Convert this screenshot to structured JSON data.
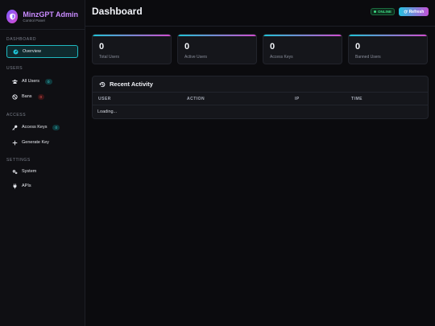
{
  "brand": {
    "title": "MinzGPT Admin",
    "subtitle": "Control Panel"
  },
  "sidebar": {
    "sections": {
      "dashboard": "DASHBOARD",
      "users": "USERS",
      "access": "ACCESS",
      "settings": "SETTINGS"
    },
    "items": {
      "overview": {
        "label": "Overview",
        "icon": "gauge-icon",
        "active": true
      },
      "all_users": {
        "label": "All Users",
        "icon": "users-icon",
        "badge": "0"
      },
      "bans": {
        "label": "Bans",
        "icon": "ban-icon",
        "badge": "0"
      },
      "access_keys": {
        "label": "Access Keys",
        "icon": "key-icon",
        "badge": "0"
      },
      "generate_key": {
        "label": "Generate Key",
        "icon": "plus-icon"
      },
      "system": {
        "label": "System",
        "icon": "gears-icon"
      },
      "apis": {
        "label": "APIs",
        "icon": "plug-icon"
      }
    }
  },
  "header": {
    "title": "Dashboard",
    "status": "ONLINE",
    "refresh_label": "Refresh"
  },
  "stats": [
    {
      "value": "0",
      "label": "Total Users"
    },
    {
      "value": "0",
      "label": "Active Users"
    },
    {
      "value": "0",
      "label": "Access Keys"
    },
    {
      "value": "0",
      "label": "Banned Users"
    }
  ],
  "activity": {
    "title": "Recent Activity",
    "columns": [
      "USER",
      "ACTION",
      "IP",
      "TIME"
    ],
    "loading_text": "Loading..."
  },
  "colors": {
    "accent_teal": "#1fc3d6",
    "accent_magenta": "#d24ccf",
    "online_green": "#3ddc84",
    "danger_red": "#ff5a5a",
    "background": "#0b0b0e"
  }
}
